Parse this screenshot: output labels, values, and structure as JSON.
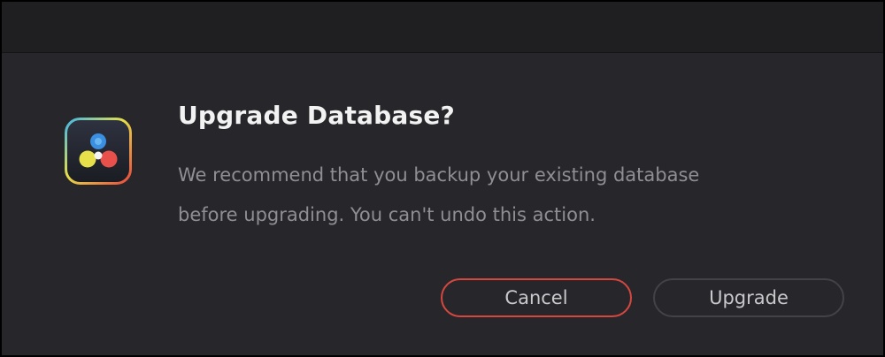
{
  "dialog": {
    "title": "Upgrade Database?",
    "message": "We recommend that you backup your existing database\nbefore upgrading. You can't undo this action.",
    "icon": "davinci-resolve-icon"
  },
  "buttons": {
    "cancel_label": "Cancel",
    "upgrade_label": "Upgrade"
  },
  "colors": {
    "background": "#27272b",
    "titlebar": "#1f1f22",
    "cancel_border": "#d6473f",
    "upgrade_border": "#434347",
    "title_text": "#f2f2f2",
    "message_text": "#8f8f93"
  }
}
